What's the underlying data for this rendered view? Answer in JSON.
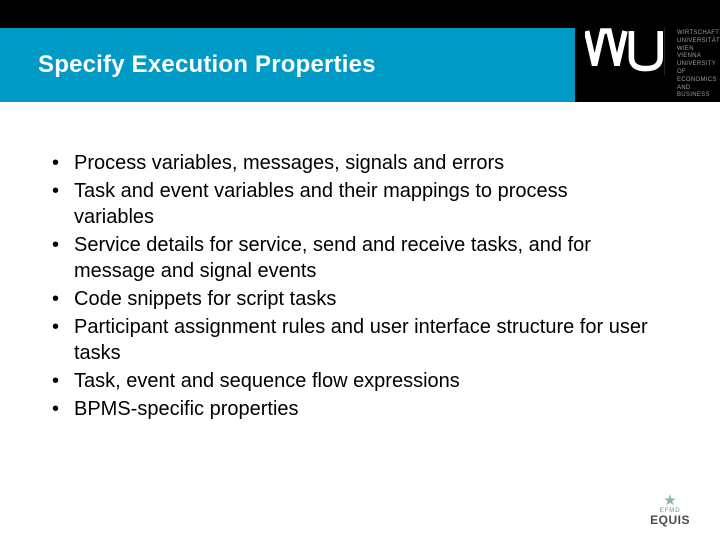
{
  "header": {
    "title": "Specify Execution Properties"
  },
  "logo": {
    "mark": "WU",
    "lines": [
      "WIRTSCHAFTS",
      "UNIVERSITÄT",
      "WIEN VIENNA",
      "UNIVERSITY OF",
      "ECONOMICS",
      "AND BUSINESS"
    ]
  },
  "bullets": [
    "Process variables, messages, signals and errors",
    "Task and event variables and their mappings to process variables",
    "Service details for service, send and receive tasks, and for message and signal events",
    "Code snippets for script tasks",
    "Participant assignment rules and user interface structure for user tasks",
    "Task, event and sequence flow expressions",
    "BPMS-specific properties"
  ],
  "footer": {
    "line1": "EFMD",
    "line2": "EQUIS"
  }
}
